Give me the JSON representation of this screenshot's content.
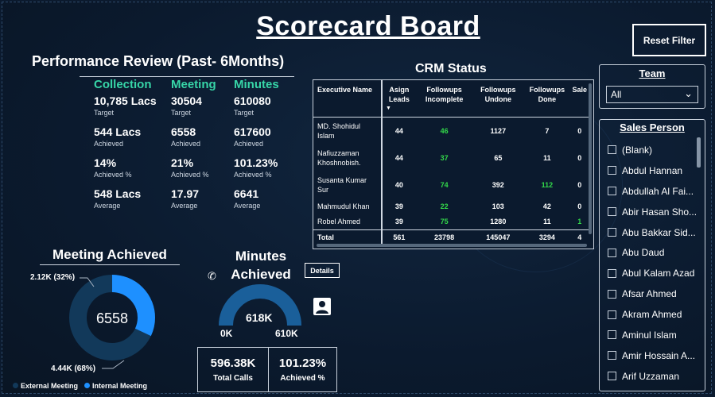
{
  "title": "Scorecard Board",
  "reset_filter_label": "Reset Filter",
  "performance": {
    "title": "Performance Review (Past- 6Months)",
    "columns": [
      {
        "header": "Collection",
        "items": [
          {
            "value": "10,785 Lacs",
            "label": "Target"
          },
          {
            "value": "544 Lacs",
            "label": "Achieved"
          },
          {
            "value": "14%",
            "label": "Achieved %"
          },
          {
            "value": "548 Lacs",
            "label": "Average"
          }
        ]
      },
      {
        "header": "Meeting",
        "items": [
          {
            "value": "30504",
            "label": "Target"
          },
          {
            "value": "6558",
            "label": "Achieved"
          },
          {
            "value": "21%",
            "label": "Achieved %"
          },
          {
            "value": "17.97",
            "label": "Average"
          }
        ]
      },
      {
        "header": "Minutes",
        "items": [
          {
            "value": "610080",
            "label": "Target"
          },
          {
            "value": "617600",
            "label": "Achieved"
          },
          {
            "value": "101.23%",
            "label": "Achieved %"
          },
          {
            "value": "6641",
            "label": "Average"
          }
        ]
      }
    ]
  },
  "crm": {
    "title": "CRM Status",
    "headers": [
      "Executive Name",
      "Asign Leads",
      "Followups Incomplete",
      "Followups Undone",
      "Followups Done",
      "Sale"
    ],
    "rows": [
      {
        "name": "MD. Shohidul Islam",
        "asign": "44",
        "incomplete": "46",
        "undone": "1127",
        "done": "7",
        "sale": "0"
      },
      {
        "name": "Nafiuzzaman Khoshnobish.",
        "asign": "44",
        "incomplete": "37",
        "undone": "65",
        "done": "11",
        "sale": "0"
      },
      {
        "name": "Susanta Kumar Sur",
        "asign": "40",
        "incomplete": "74",
        "undone": "392",
        "done": "112",
        "sale": "0"
      },
      {
        "name": "Mahmudul Khan",
        "asign": "39",
        "incomplete": "22",
        "undone": "103",
        "done": "42",
        "sale": "0"
      },
      {
        "name": "Robel Ahmed",
        "asign": "39",
        "incomplete": "75",
        "undone": "1280",
        "done": "11",
        "sale": "1"
      }
    ],
    "total": {
      "name": "Total",
      "asign": "561",
      "incomplete": "23798",
      "undone": "145047",
      "done": "3294",
      "sale": "4"
    }
  },
  "team": {
    "title": "Team",
    "selected": "All"
  },
  "sales_person": {
    "title": "Sales Person",
    "items": [
      "(Blank)",
      "Abdul Hannan",
      "Abdullah Al Fai...",
      "Abir Hasan Sho...",
      "Abu Bakkar Sid...",
      "Abu Daud",
      "Abul Kalam Azad",
      "Afsar Ahmed",
      "Akram Ahmed",
      "Aminul Islam",
      "Amir Hossain A...",
      "Arif Uzzaman"
    ]
  },
  "meeting": {
    "title": "Meeting Achieved",
    "center_value": "6558",
    "external_label": "4.44K (68%)",
    "internal_label": "2.12K (32%)",
    "legend_external": "External Meeting",
    "legend_internal": "Internal Meeting",
    "external_fraction": 0.68,
    "internal_fraction": 0.32,
    "colors": {
      "external": "#12395a",
      "internal": "#1e90ff"
    }
  },
  "minutes": {
    "title": "Minutes Achieved",
    "details_label": "Details",
    "gauge_value": "618K",
    "gauge_min": "0K",
    "gauge_max": "610K",
    "gauge_fraction": 1.0,
    "total_calls_value": "596.38K",
    "total_calls_label": "Total Calls",
    "achieved_pct_value": "101.23%",
    "achieved_pct_label": "Achieved %"
  }
}
